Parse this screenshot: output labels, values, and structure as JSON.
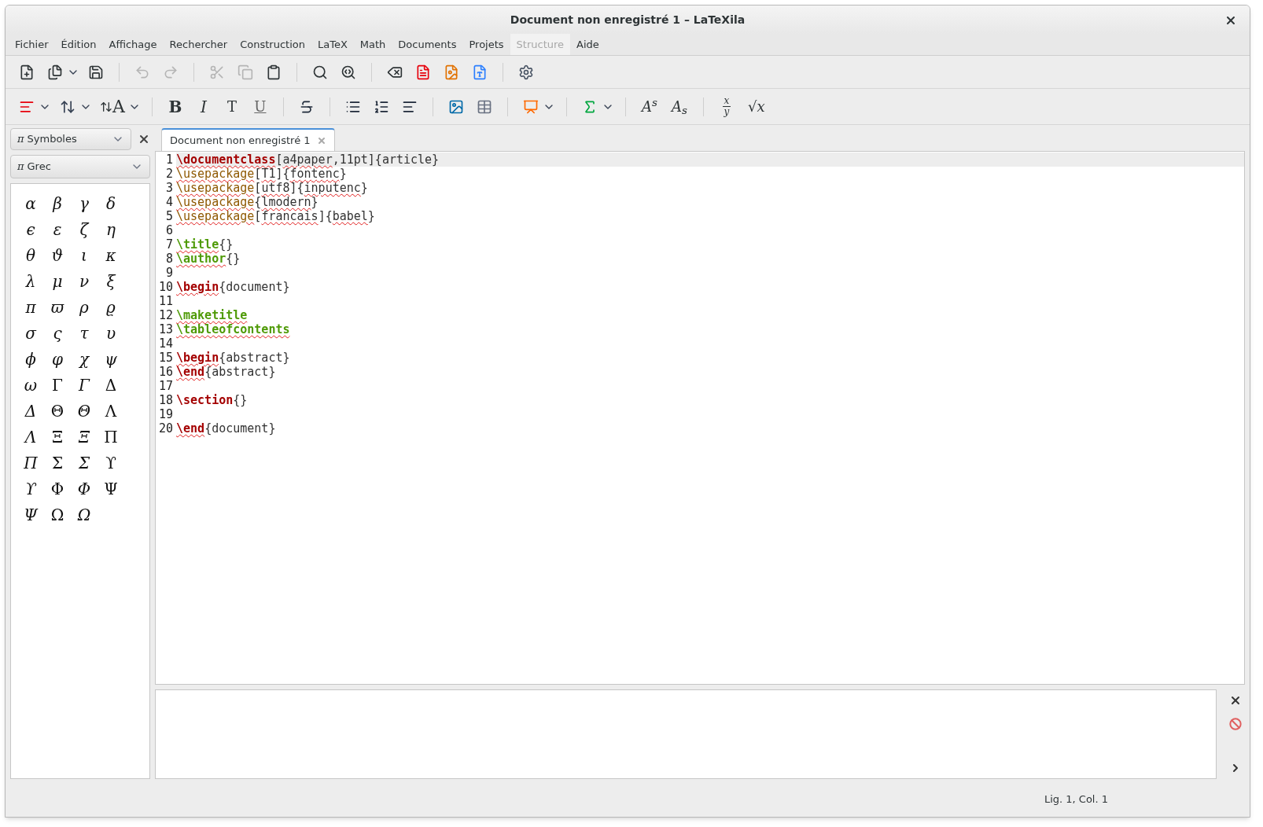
{
  "window": {
    "title": "Document non enregistré 1 – LaTeXila"
  },
  "menu": [
    {
      "label": "Fichier",
      "disabled": false
    },
    {
      "label": "Édition",
      "disabled": false
    },
    {
      "label": "Affichage",
      "disabled": false
    },
    {
      "label": "Rechercher",
      "disabled": false
    },
    {
      "label": "Construction",
      "disabled": false
    },
    {
      "label": "LaTeX",
      "disabled": false
    },
    {
      "label": "Math",
      "disabled": false
    },
    {
      "label": "Documents",
      "disabled": false
    },
    {
      "label": "Projets",
      "disabled": false
    },
    {
      "label": "Structure",
      "disabled": true
    },
    {
      "label": "Aide",
      "disabled": false
    }
  ],
  "toolbar": [
    {
      "kind": "new",
      "disabled": false
    },
    {
      "kind": "open",
      "disabled": false,
      "dropdown": true
    },
    {
      "kind": "save",
      "disabled": false
    },
    {
      "kind": "sep"
    },
    {
      "kind": "undo",
      "disabled": true
    },
    {
      "kind": "redo",
      "disabled": true
    },
    {
      "kind": "sep"
    },
    {
      "kind": "cut",
      "disabled": true
    },
    {
      "kind": "copy",
      "disabled": true
    },
    {
      "kind": "paste",
      "disabled": false
    },
    {
      "kind": "sep"
    },
    {
      "kind": "find",
      "disabled": false
    },
    {
      "kind": "replace",
      "disabled": false
    },
    {
      "kind": "sep"
    },
    {
      "kind": "clean",
      "disabled": false
    },
    {
      "kind": "pdf",
      "disabled": false
    },
    {
      "kind": "dvi",
      "disabled": false
    },
    {
      "kind": "ps",
      "disabled": false
    },
    {
      "kind": "sep"
    },
    {
      "kind": "build",
      "disabled": false
    }
  ],
  "latex_toolbar": [
    {
      "kind": "sectioning",
      "dropdown": true
    },
    {
      "kind": "spacing",
      "dropdown": true
    },
    {
      "kind": "fontsize",
      "label": "A",
      "dropdown": true
    },
    {
      "kind": "sep"
    },
    {
      "kind": "bold",
      "label": "B"
    },
    {
      "kind": "italic",
      "label": "I"
    },
    {
      "kind": "typewriter",
      "label": "T"
    },
    {
      "kind": "underline",
      "label": "U"
    },
    {
      "kind": "sep"
    },
    {
      "kind": "strike"
    },
    {
      "kind": "sep"
    },
    {
      "kind": "itemize"
    },
    {
      "kind": "enumerate"
    },
    {
      "kind": "description"
    },
    {
      "kind": "sep"
    },
    {
      "kind": "image"
    },
    {
      "kind": "table"
    },
    {
      "kind": "sep"
    },
    {
      "kind": "presentation",
      "dropdown": true
    },
    {
      "kind": "sep"
    },
    {
      "kind": "sum",
      "dropdown": true
    },
    {
      "kind": "sep"
    },
    {
      "kind": "sup",
      "label": "A$^{s}$"
    },
    {
      "kind": "sub",
      "label": "A$_{s}$"
    },
    {
      "kind": "sep"
    },
    {
      "kind": "frac",
      "label": "x",
      "label2": "y"
    },
    {
      "kind": "sqrt",
      "label": "√x"
    }
  ],
  "side_panel": {
    "panel_icon": "π",
    "panel_select": "Symboles",
    "category_icon": "π",
    "category_select": "Grec",
    "symbols": [
      {
        "c": "α",
        "italic": true
      },
      {
        "c": "β",
        "italic": true
      },
      {
        "c": "γ",
        "italic": true
      },
      {
        "c": "δ",
        "italic": true
      },
      {
        "c": "ϵ",
        "italic": true
      },
      {
        "c": "ε",
        "italic": true
      },
      {
        "c": "ζ",
        "italic": true
      },
      {
        "c": "η",
        "italic": true
      },
      {
        "c": "θ",
        "italic": true
      },
      {
        "c": "ϑ",
        "italic": true
      },
      {
        "c": "ι",
        "italic": true
      },
      {
        "c": "κ",
        "italic": true
      },
      {
        "c": "λ",
        "italic": true
      },
      {
        "c": "μ",
        "italic": true
      },
      {
        "c": "ν",
        "italic": true
      },
      {
        "c": "ξ",
        "italic": true
      },
      {
        "c": "π",
        "italic": true
      },
      {
        "c": "ϖ",
        "italic": true
      },
      {
        "c": "ρ",
        "italic": true
      },
      {
        "c": "ϱ",
        "italic": true
      },
      {
        "c": "σ",
        "italic": true
      },
      {
        "c": "ς",
        "italic": true
      },
      {
        "c": "τ",
        "italic": true
      },
      {
        "c": "υ",
        "italic": true
      },
      {
        "c": "ϕ",
        "italic": true
      },
      {
        "c": "φ",
        "italic": true
      },
      {
        "c": "χ",
        "italic": true
      },
      {
        "c": "ψ",
        "italic": true
      },
      {
        "c": "ω",
        "italic": true
      },
      {
        "c": "Γ",
        "italic": false
      },
      {
        "c": "Γ",
        "italic": true
      },
      {
        "c": "Δ",
        "italic": false
      },
      {
        "c": "Δ",
        "italic": true
      },
      {
        "c": "Θ",
        "italic": false
      },
      {
        "c": "Θ",
        "italic": true
      },
      {
        "c": "Λ",
        "italic": false
      },
      {
        "c": "Λ",
        "italic": true
      },
      {
        "c": "Ξ",
        "italic": false
      },
      {
        "c": "Ξ",
        "italic": true
      },
      {
        "c": "Π",
        "italic": false
      },
      {
        "c": "Π",
        "italic": true
      },
      {
        "c": "Σ",
        "italic": false
      },
      {
        "c": "Σ",
        "italic": true
      },
      {
        "c": "ϒ",
        "italic": false
      },
      {
        "c": "ϒ",
        "italic": true
      },
      {
        "c": "Φ",
        "italic": false
      },
      {
        "c": "Φ",
        "italic": true
      },
      {
        "c": "Ψ",
        "italic": false
      },
      {
        "c": "Ψ",
        "italic": true
      },
      {
        "c": "Ω",
        "italic": false
      },
      {
        "c": "Ω",
        "italic": true
      }
    ]
  },
  "tabs": [
    {
      "label": "Document non enregistré 1",
      "selected": true
    }
  ],
  "editor": {
    "lines": [
      {
        "n": "1",
        "current": true,
        "tokens": [
          {
            "t": "\\documentclass",
            "kind": "red",
            "spell": true
          },
          {
            "t": "[",
            "kind": "plain",
            "spell": false
          },
          {
            "t": "a4paper",
            "kind": "plain",
            "spell": true
          },
          {
            "t": ",11pt]{article}",
            "kind": "plain",
            "spell": false
          }
        ]
      },
      {
        "n": "2",
        "current": false,
        "tokens": [
          {
            "t": "\\usepackage",
            "kind": "brown",
            "spell": true
          },
          {
            "t": "[",
            "kind": "plain",
            "spell": false
          },
          {
            "t": "T1",
            "kind": "plain",
            "spell": true
          },
          {
            "t": "]{",
            "kind": "plain",
            "spell": false
          },
          {
            "t": "fontenc",
            "kind": "plain",
            "spell": true
          },
          {
            "t": "}",
            "kind": "plain",
            "spell": false
          }
        ]
      },
      {
        "n": "3",
        "current": false,
        "tokens": [
          {
            "t": "\\usepackage",
            "kind": "brown",
            "spell": true
          },
          {
            "t": "[",
            "kind": "plain",
            "spell": false
          },
          {
            "t": "utf8",
            "kind": "plain",
            "spell": true
          },
          {
            "t": "]{",
            "kind": "plain",
            "spell": false
          },
          {
            "t": "inputenc",
            "kind": "plain",
            "spell": true
          },
          {
            "t": "}",
            "kind": "plain",
            "spell": false
          }
        ]
      },
      {
        "n": "4",
        "current": false,
        "tokens": [
          {
            "t": "\\usepackage",
            "kind": "brown",
            "spell": true
          },
          {
            "t": "{",
            "kind": "plain",
            "spell": false
          },
          {
            "t": "lmodern",
            "kind": "plain",
            "spell": true
          },
          {
            "t": "}",
            "kind": "plain",
            "spell": false
          }
        ]
      },
      {
        "n": "5",
        "current": false,
        "tokens": [
          {
            "t": "\\usepackage",
            "kind": "brown",
            "spell": true
          },
          {
            "t": "[",
            "kind": "plain",
            "spell": false
          },
          {
            "t": "francais",
            "kind": "plain",
            "spell": true
          },
          {
            "t": "]{",
            "kind": "plain",
            "spell": false
          },
          {
            "t": "babel",
            "kind": "plain",
            "spell": true
          },
          {
            "t": "}",
            "kind": "plain",
            "spell": false
          }
        ]
      },
      {
        "n": "6",
        "current": false
      },
      {
        "n": "7",
        "current": false,
        "tokens": [
          {
            "t": "\\title",
            "kind": "green",
            "spell": true
          },
          {
            "t": "{}",
            "kind": "plain",
            "spell": false
          }
        ]
      },
      {
        "n": "8",
        "current": false,
        "tokens": [
          {
            "t": "\\author",
            "kind": "green",
            "spell": true
          },
          {
            "t": "{}",
            "kind": "plain",
            "spell": false
          }
        ]
      },
      {
        "n": "9",
        "current": false
      },
      {
        "n": "10",
        "current": false,
        "tokens": [
          {
            "t": "\\begin",
            "kind": "red",
            "spell": true
          },
          {
            "t": "{document}",
            "kind": "plain",
            "spell": false
          }
        ]
      },
      {
        "n": "11",
        "current": false
      },
      {
        "n": "12",
        "current": false,
        "tokens": [
          {
            "t": "\\maketitle",
            "kind": "green",
            "spell": true
          }
        ]
      },
      {
        "n": "13",
        "current": false,
        "tokens": [
          {
            "t": "\\tableofcontents",
            "kind": "green",
            "spell": true
          }
        ]
      },
      {
        "n": "14",
        "current": false
      },
      {
        "n": "15",
        "current": false,
        "tokens": [
          {
            "t": "\\begin",
            "kind": "red",
            "spell": true
          },
          {
            "t": "{abstract}",
            "kind": "plain",
            "spell": false
          }
        ]
      },
      {
        "n": "16",
        "current": false,
        "tokens": [
          {
            "t": "\\end",
            "kind": "red",
            "spell": true
          },
          {
            "t": "{abstract}",
            "kind": "plain",
            "spell": false
          }
        ]
      },
      {
        "n": "17",
        "current": false
      },
      {
        "n": "18",
        "current": false,
        "tokens": [
          {
            "t": "\\section",
            "kind": "red",
            "spell": false
          },
          {
            "t": "{}",
            "kind": "plain",
            "spell": false
          }
        ]
      },
      {
        "n": "19",
        "current": false
      },
      {
        "n": "20",
        "current": false,
        "tokens": [
          {
            "t": "\\end",
            "kind": "red",
            "spell": true
          },
          {
            "t": "{document}",
            "kind": "plain",
            "spell": false
          }
        ]
      }
    ]
  },
  "status_bar": {
    "position": "Lig. 1, Col. 1"
  }
}
